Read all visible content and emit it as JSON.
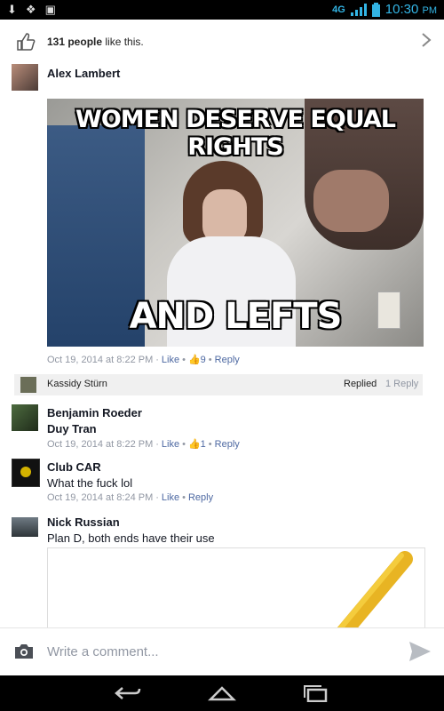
{
  "status_bar": {
    "network": "4G",
    "time": "10:30",
    "ampm": "PM"
  },
  "likes": {
    "count": "131 people",
    "suffix": " like this."
  },
  "post": {
    "author": "Alex Lambert",
    "meme_top_caption": "WOMEN DESERVE EQUAL RIGHTS",
    "meme_bottom_caption": "AND LEFTS",
    "timestamp": "Oct 19, 2014 at 8:22 PM",
    "like_label": "Like",
    "like_count": "9",
    "reply_label": "Reply"
  },
  "reply_summary": {
    "name": "Kassidy Stürn",
    "status": "Replied",
    "count": "1 Reply"
  },
  "comments": [
    {
      "author": "Benjamin Roeder",
      "text": "Duy Tran",
      "timestamp": "Oct 19, 2014 at 8:22 PM",
      "like_label": "Like",
      "like_count": "1",
      "reply_label": "Reply"
    },
    {
      "author": "Club CAR",
      "text": "What the fuck lol",
      "timestamp": "Oct 19, 2014 at 8:24 PM",
      "like_label": "Like",
      "reply_label": "Reply"
    },
    {
      "author": "Nick Russian",
      "text": "Plan D, both ends have their use"
    }
  ],
  "composer": {
    "placeholder": "Write a comment..."
  },
  "colors": {
    "link": "#4e69a2",
    "meta": "#9197a3",
    "status_accent": "#33b5e5"
  }
}
